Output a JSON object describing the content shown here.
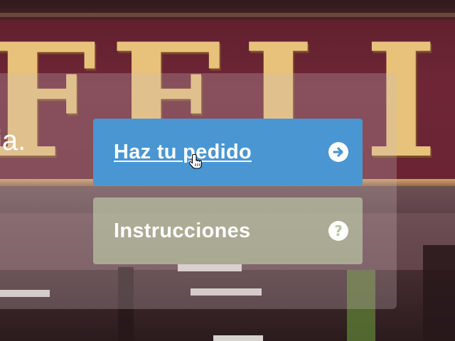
{
  "background": {
    "sign_text": "FELIP",
    "colors": {
      "sign": "#6a2434",
      "lettering": "#e8c27a"
    }
  },
  "overlay": {
    "partial_text": "ia."
  },
  "buttons": [
    {
      "label": "Haz tu pedido",
      "icon": "arrow-right-circle-icon",
      "color": "#4a96d2",
      "state": "hover"
    },
    {
      "label": "Instrucciones",
      "icon": "question-circle-icon",
      "color": "#c4d4ac"
    }
  ],
  "cursor": {
    "icon": "hand-pointer-icon"
  }
}
